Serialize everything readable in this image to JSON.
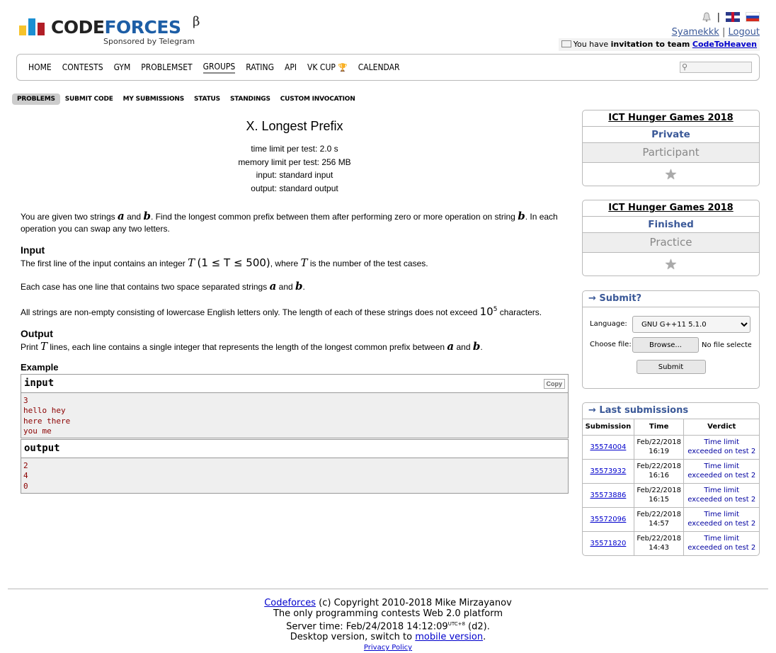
{
  "header": {
    "logo_text_1": "CODE",
    "logo_text_2": "FORCES",
    "logo_beta": "β",
    "logo_sponsor": "Sponsored by Telegram",
    "separator": "|",
    "username": "Syamekkk",
    "logout": "Logout",
    "invite_prefix": "You have",
    "invite_bold": "invitation to team",
    "invite_team": "CodeToHeaven"
  },
  "menu": {
    "items": [
      "HOME",
      "CONTESTS",
      "GYM",
      "PROBLEMSET",
      "GROUPS",
      "RATING",
      "API",
      "VK CUP",
      "CALENDAR"
    ],
    "current": "GROUPS",
    "search_value": ""
  },
  "secmenu": {
    "items": [
      "PROBLEMS",
      "SUBMIT CODE",
      "MY SUBMISSIONS",
      "STATUS",
      "STANDINGS",
      "CUSTOM INVOCATION"
    ],
    "active": "PROBLEMS"
  },
  "problem": {
    "title": "X. Longest Prefix",
    "time_limit": "time limit per test: 2.0 s",
    "memory_limit": "memory limit per test: 256 MB",
    "input": "input: standard input",
    "output": "output: standard output",
    "legend": {
      "t1": "You are given two strings",
      "a": "a",
      "and": "and",
      "b": "b",
      "t2": ". Find the longest common prefix between them after performing zero or more operation on string",
      "t3": ". In each operation you can swap any two letters."
    },
    "input_title": "Input",
    "input_p1_a": "The first line of the input contains an integer",
    "input_p1_T": "T",
    "input_p1_cond": "(1 ≤ T ≤ 500)",
    "input_p1_b": ", where",
    "input_p1_c": "is the number of the test cases.",
    "input_p2": "Each case has one line that contains two space separated strings",
    "input_p3_a": "All strings are non-empty consisting of lowercase English letters only. The length of each of these strings does not exceed",
    "input_p3_base": "10",
    "input_p3_exp": "5",
    "input_p3_b": "characters.",
    "output_title": "Output",
    "output_p_a": "Print",
    "output_p_b": "lines, each line contains a single integer that represents the length of the longest common prefix between",
    "example_title": "Example",
    "sample_input_label": "input",
    "sample_output_label": "output",
    "copy_label": "Copy",
    "sample_input_lines": [
      "3",
      "hello hey",
      "here there",
      "you me"
    ],
    "sample_output_lines": [
      "2",
      "4",
      "0"
    ]
  },
  "sidebar": {
    "groups": [
      {
        "name": "ICT Hunger Games 2018",
        "status": "Private",
        "role": "Participant"
      },
      {
        "name": "ICT Hunger Games 2018",
        "status": "Finished",
        "role": "Practice"
      }
    ],
    "submit": {
      "caption": "→ Submit?",
      "language_label": "Language:",
      "language_value": "GNU G++11 5.1.0",
      "file_label": "Choose file:",
      "browse_label": "Browse...",
      "no_file": "No file selected.",
      "submit_label": "Submit"
    },
    "last": {
      "caption": "→ Last submissions",
      "headers": [
        "Submission",
        "Time",
        "Verdict"
      ],
      "rows": [
        {
          "id": "35574004",
          "date": "Feb/22/2018",
          "time": "16:19",
          "v1": "Time limit",
          "v2": "exceeded on test 2"
        },
        {
          "id": "35573932",
          "date": "Feb/22/2018",
          "time": "16:16",
          "v1": "Time limit",
          "v2": "exceeded on test 2"
        },
        {
          "id": "35573886",
          "date": "Feb/22/2018",
          "time": "16:15",
          "v1": "Time limit",
          "v2": "exceeded on test 2"
        },
        {
          "id": "35572096",
          "date": "Feb/22/2018",
          "time": "14:57",
          "v1": "Time limit",
          "v2": "exceeded on test 2"
        },
        {
          "id": "35571820",
          "date": "Feb/22/2018",
          "time": "14:43",
          "v1": "Time limit",
          "v2": "exceeded on test 2"
        }
      ]
    }
  },
  "footer": {
    "link": "Codeforces",
    "copyright": "(c) Copyright 2010-2018 Mike Mirzayanov",
    "line2": "The only programming contests Web 2.0 platform",
    "server_time": "Server time: Feb/24/2018 14:12:09",
    "tz": "UTC+8",
    "d2": "(d2).",
    "desktop": "Desktop version, switch to",
    "mobile": "mobile version",
    "period": ".",
    "privacy": "Privacy Policy"
  },
  "colors": {
    "link": "#0000cc",
    "caption_blue": "#3b5998",
    "verdict": "#0000a0",
    "sample_text": "#8b0000"
  }
}
